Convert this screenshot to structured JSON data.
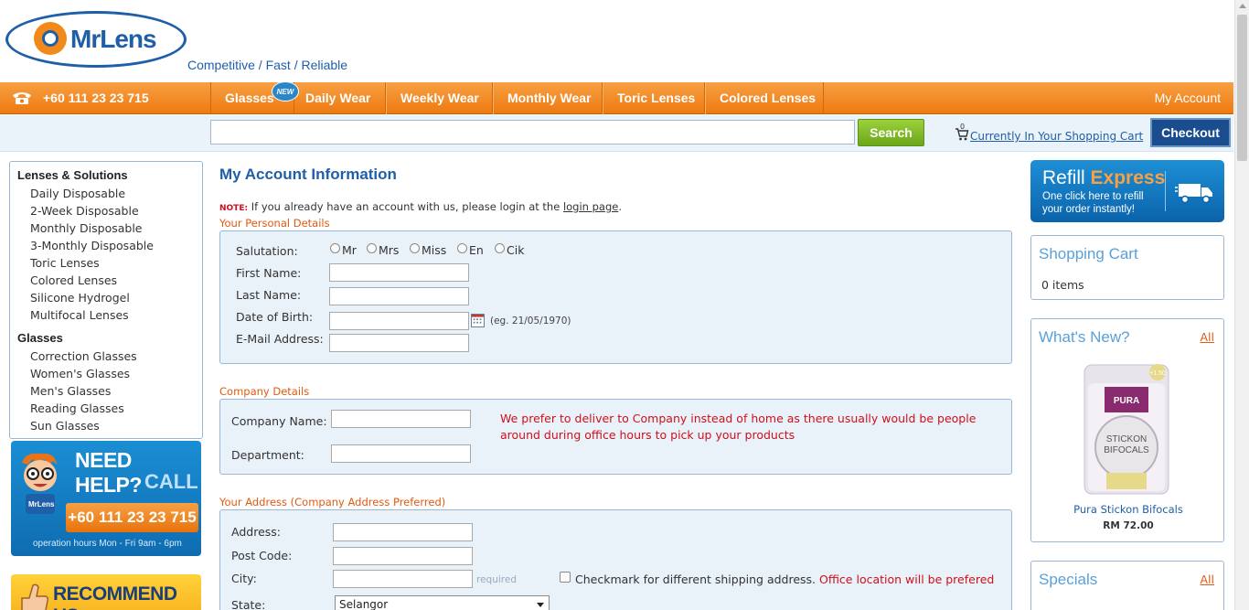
{
  "header": {
    "logo_text": "MrLens",
    "tagline": "Competitive / Fast / Reliable"
  },
  "nav": {
    "phone": "+60 111 23 23 715",
    "items": [
      "Glasses",
      "Daily Wear",
      "Weekly Wear",
      "Monthly Wear",
      "Toric Lenses",
      "Colored Lenses"
    ],
    "new_badge": "NEW",
    "my_account": "My Account"
  },
  "search": {
    "value": "",
    "button": "Search",
    "cart_count": "0",
    "cart_link": "Currently In Your Shopping Cart",
    "checkout": "Checkout"
  },
  "sidebar": {
    "lenses_title": "Lenses & Solutions",
    "lenses_items": [
      "Daily Disposable",
      "2-Week Disposable",
      "Monthly Disposable",
      "3-Monthly Disposable",
      "Toric Lenses",
      "Colored Lenses",
      "Silicone Hydrogel",
      "Multifocal Lenses"
    ],
    "glasses_title": "Glasses",
    "glasses_items": [
      "Correction Glasses",
      "Women's Glasses",
      "Men's Glasses",
      "Reading Glasses",
      "Sun Glasses"
    ],
    "help_banner": {
      "title": "NEED HELP?",
      "call": "CALL",
      "brand": "MrLens",
      "phone": "+60 111 23 23 715",
      "hours": "operation hours Mon - Fri 9am - 6pm"
    },
    "recommend": "RECOMMEND US"
  },
  "main": {
    "title": "My Account Information",
    "note_label": "NOTE:",
    "note_text": " If you already have an account with us, please login at the ",
    "note_link": "login page",
    "note_end": ".",
    "personal": {
      "label": "Your Personal Details",
      "salutation_label": "Salutation:",
      "salutations": [
        "Mr",
        "Mrs",
        "Miss",
        "En",
        "Cik"
      ],
      "first_name": "First Name:",
      "last_name": "Last Name:",
      "dob": "Date of Birth:",
      "dob_hint": "(eg. 21/05/1970)",
      "email": "E-Mail Address:"
    },
    "company": {
      "label": "Company Details",
      "company_name": "Company Name:",
      "department": "Department:",
      "message": "We prefer to deliver to Company instead of home as there usually would be people around during office hours to pick up your products"
    },
    "address": {
      "label": "Your Address (Company Address Preferred)",
      "address": "Address:",
      "post_code": "Post Code:",
      "city": "City:",
      "required": "required",
      "checkbox_text": "Checkmark for different shipping address.",
      "checkbox_red": " Office location will be prefered",
      "state": "State:",
      "state_value": "Selangor"
    }
  },
  "right": {
    "refill_a": "Refill",
    "refill_b": "Express",
    "refill_sub": "One click here to refill your order instantly!",
    "cart_title": "Shopping Cart",
    "cart_items": "0 items",
    "whats_new": "What's New?",
    "all": "All",
    "product_brand": "PURA",
    "product_line1": "STICKON",
    "product_line2": "BIFOCALS",
    "product_strength": "+1.50",
    "product_name": "Pura Stickon Bifocals",
    "product_price": "RM 72.00",
    "specials": "Specials"
  }
}
